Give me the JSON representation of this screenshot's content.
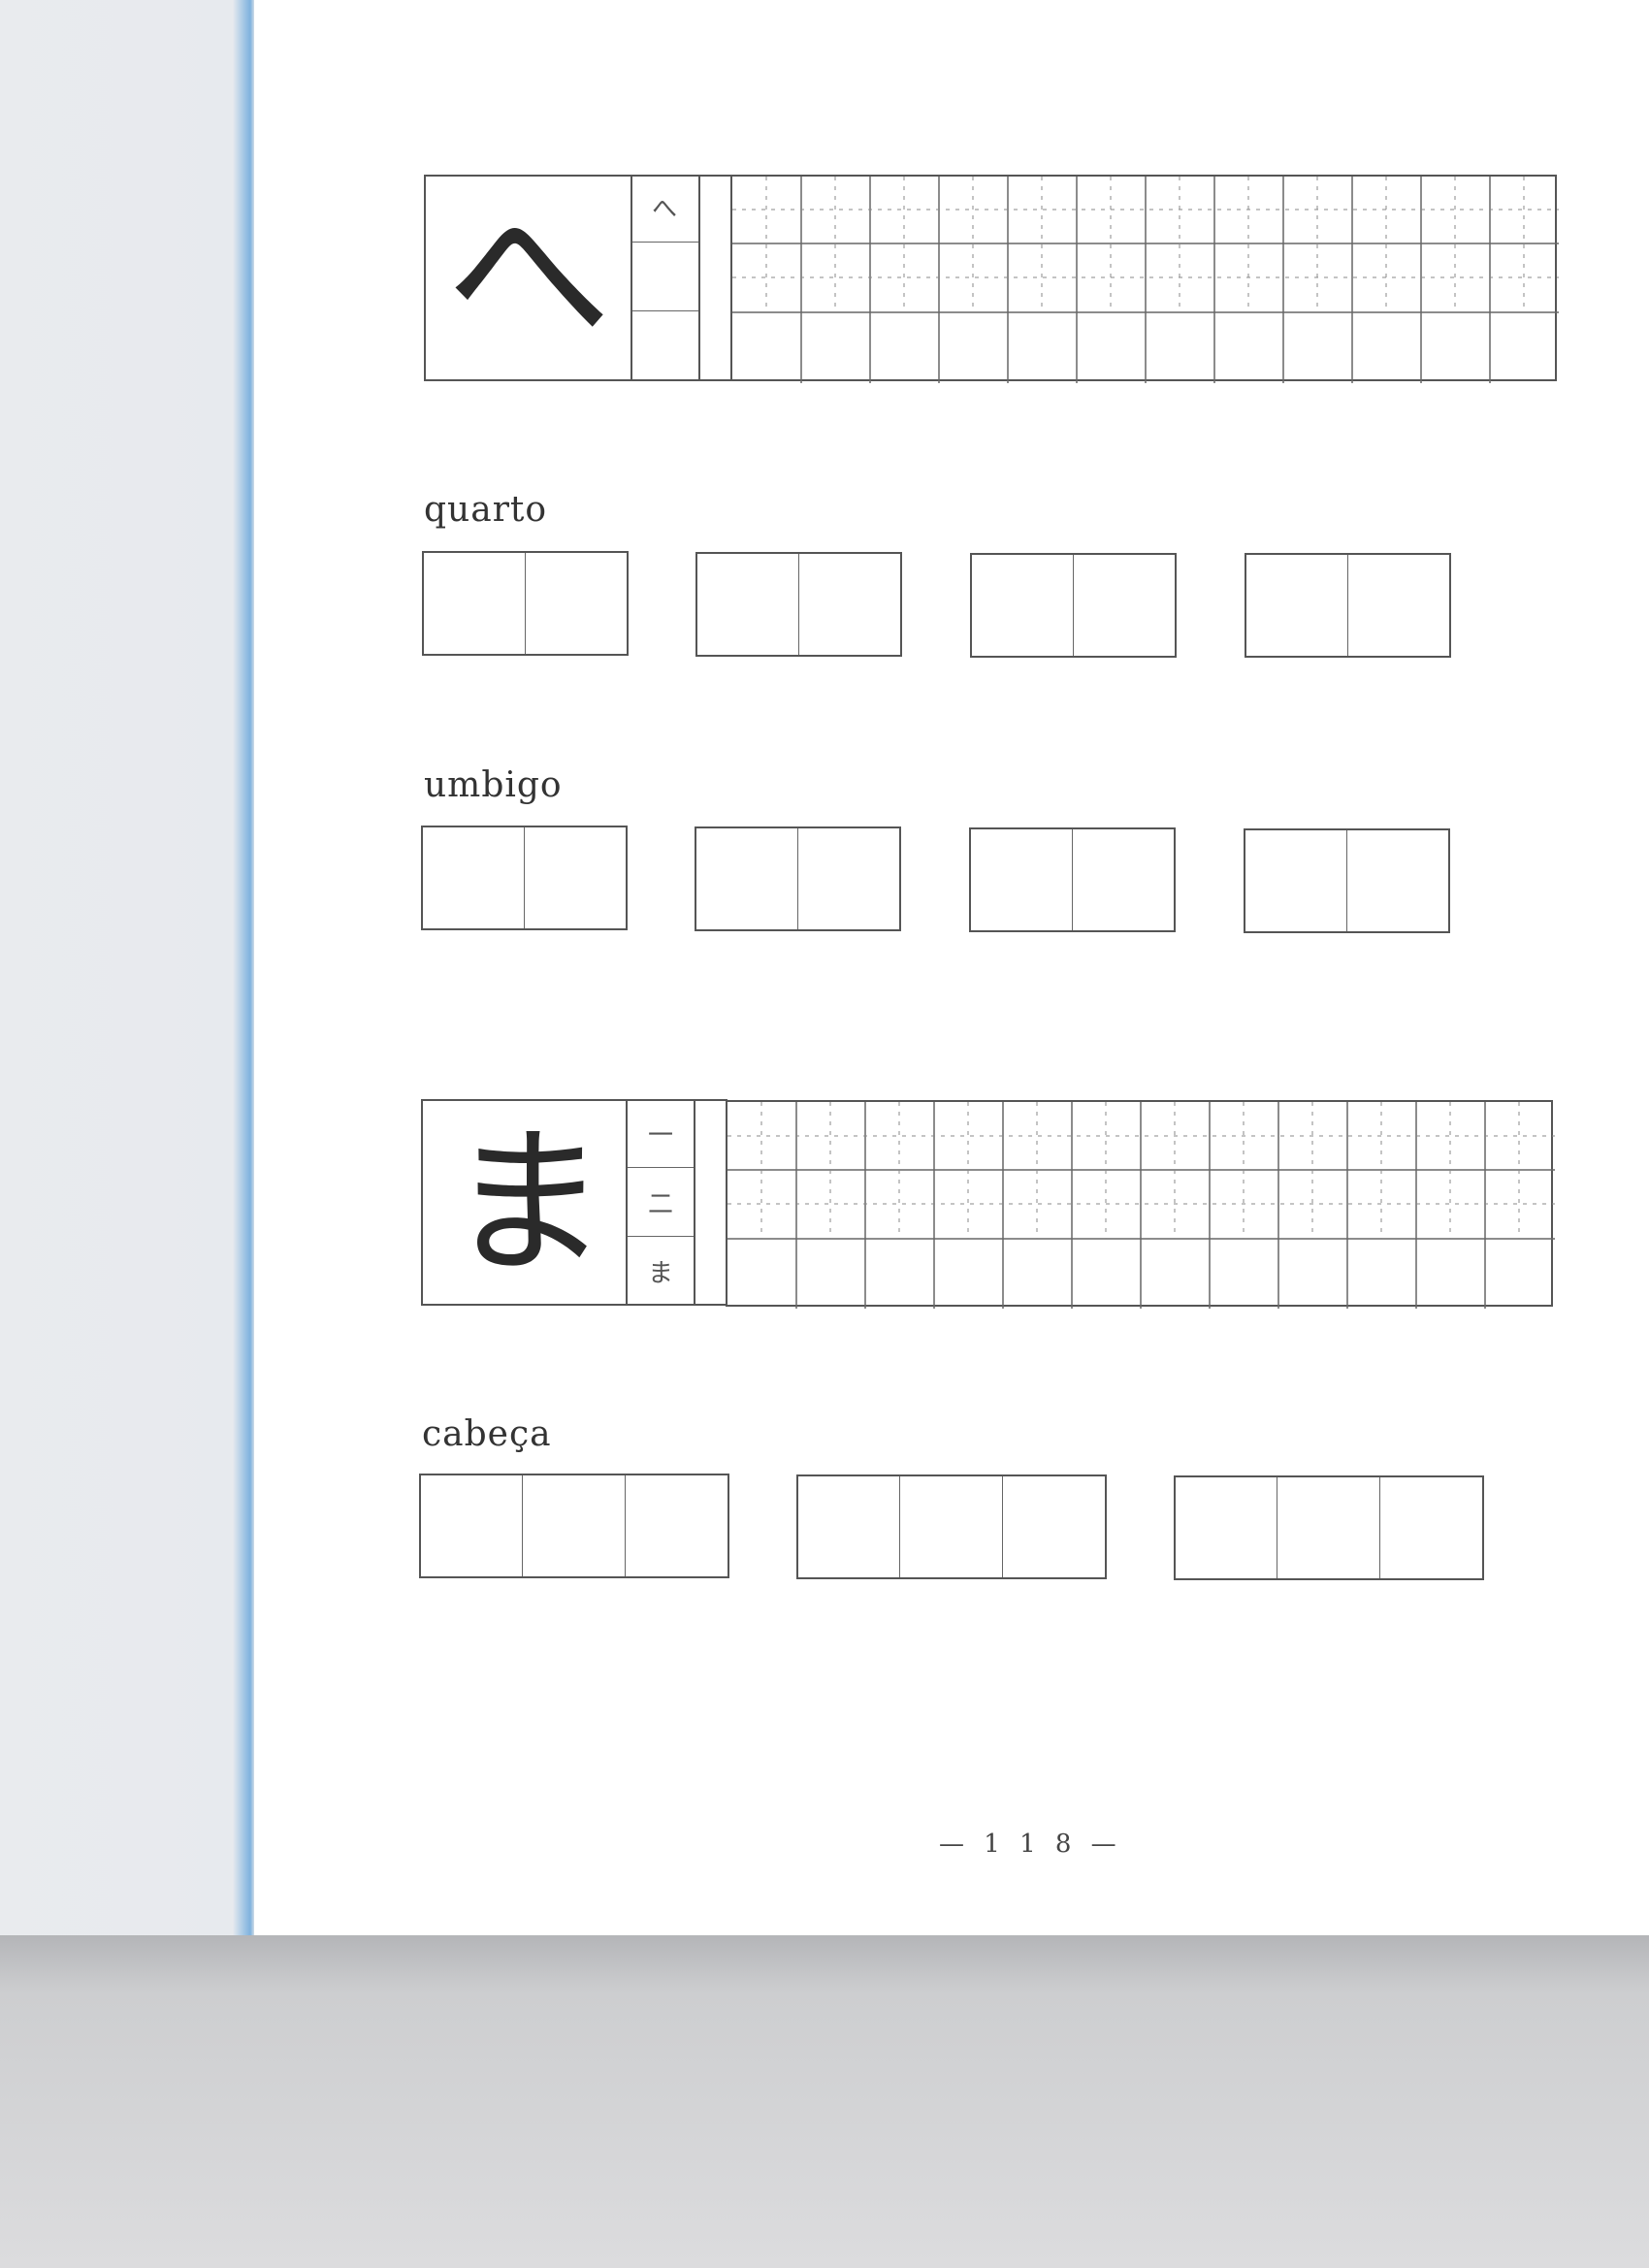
{
  "sections": [
    {
      "type": "kana-practice",
      "model_char": "へ",
      "stroke_steps": [
        "へ",
        "",
        ""
      ]
    },
    {
      "type": "word-practice",
      "word": "quarto",
      "groups": 4,
      "boxes_per_group": 2
    },
    {
      "type": "word-practice",
      "word": "umbigo",
      "groups": 4,
      "boxes_per_group": 2
    },
    {
      "type": "kana-practice",
      "model_char": "ま",
      "stroke_steps": [
        "一",
        "二",
        "ま"
      ]
    },
    {
      "type": "word-practice",
      "word": "cabeça",
      "groups": 3,
      "boxes_per_group": 3
    }
  ],
  "footer": {
    "page_number": "— 1 1 8 —"
  }
}
